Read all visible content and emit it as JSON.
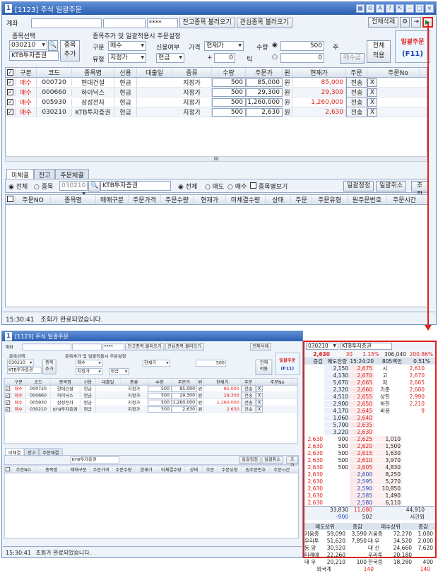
{
  "window": {
    "title": "[1123] 주식 일괄주문",
    "num": "1"
  },
  "top": {
    "account_label": "계좌",
    "password": "****",
    "load_balance": "잔고종목 불러오기",
    "load_watch": "관심종목 불러오기",
    "delete_all": "전체삭제"
  },
  "settings": {
    "select_label": "종목선택",
    "code": "030210",
    "add_label": "종목\n추가",
    "stock_name": "KTB투자증권",
    "section_label": "종목추가 및 일괄적용시 주문설정",
    "side_label": "구분",
    "side_value": "매수",
    "credit_label": "신용여부",
    "price_label": "가격",
    "price_value": "현재가",
    "qty_label": "수량",
    "qty_value": "500",
    "qty_unit": "주",
    "type_label": "유형",
    "type_value": "지정가",
    "credit_value": "현금",
    "tick_value": "0",
    "tick_unit": "틱",
    "price_input": "0",
    "bid_label": "매수금",
    "apply_label": "전체\n적용",
    "bulk_label": "일괄주문",
    "bulk_key": "(F11)"
  },
  "order_grid": {
    "headers": [
      "",
      "구분",
      "코드",
      "종목명",
      "신용",
      "대출일",
      "종류",
      "수량",
      "주문가",
      "원",
      "현재가",
      "주문",
      "",
      "주문No"
    ],
    "rows": [
      {
        "side": "매수",
        "code": "000720",
        "name": "현대건설",
        "credit": "현금",
        "type": "지정가",
        "qty": "500",
        "price": "85,000",
        "won": "원",
        "cur": "85,000",
        "send": "전송",
        "x": "X"
      },
      {
        "side": "매수",
        "code": "000660",
        "name": "하이닉스",
        "credit": "현금",
        "type": "지정가",
        "qty": "500",
        "price": "29,300",
        "won": "원",
        "cur": "29,300",
        "send": "전송",
        "x": "X"
      },
      {
        "side": "매수",
        "code": "005930",
        "name": "삼성전자",
        "credit": "현금",
        "type": "지정가",
        "qty": "500",
        "price": "1,260,000",
        "won": "원",
        "cur": "1,260,000",
        "send": "전송",
        "x": "X"
      },
      {
        "side": "매수",
        "code": "030210",
        "name": "KTB투자증권",
        "credit": "현금",
        "type": "지정가",
        "qty": "500",
        "price": "2,630",
        "won": "원",
        "cur": "2,630",
        "send": "전송",
        "x": "X"
      }
    ]
  },
  "tabs": [
    "미체결",
    "잔고",
    "주문체결"
  ],
  "filter": {
    "all": "전체",
    "stock": "종목",
    "code": "030210",
    "name": "KTB투자증권",
    "all2": "전체",
    "sell": "매도",
    "buy": "매수",
    "by_stock": "종목별보기",
    "bulk_fix": "일괄정정",
    "bulk_cancel": "일괄취소",
    "query": "조회"
  },
  "unfilled_headers": [
    "",
    "주문NO",
    "종목명",
    "매매구분",
    "주문가격",
    "주문수량",
    "현재가",
    "미체결수량",
    "상태",
    "주문",
    "주문유형",
    "원주문번호",
    "주문시간"
  ],
  "status": {
    "time": "15:30:41",
    "msg": "조회가 완료되었습니다."
  },
  "scroll_mark": "III",
  "orderbook": {
    "code": "030210",
    "name": "KTB투자증권",
    "price": "2,630",
    "change": "30",
    "rate": "1.15%",
    "volume": "306,040",
    "pct": "200.86%",
    "hdr": [
      "증감",
      "매도잔량",
      "15:24:20",
      "805백만",
      "0.51%"
    ],
    "asks": [
      [
        "2,150",
        "2,675"
      ],
      [
        "4,130",
        "2,670"
      ],
      [
        "5,670",
        "2,665"
      ],
      [
        "2,320",
        "2,660"
      ],
      [
        "4,510",
        "2,655"
      ],
      [
        "2,900",
        "2,650"
      ],
      [
        "4,170",
        "2,645"
      ],
      [
        "1,060",
        "2,640"
      ],
      [
        "5,700",
        "2,635"
      ],
      [
        "3,220",
        "2,630"
      ]
    ],
    "bids": [
      [
        "2,625",
        "1,010"
      ],
      [
        "2,620",
        "1,500"
      ],
      [
        "2,615",
        "1,630"
      ],
      [
        "2,610",
        "3,970"
      ],
      [
        "2,605",
        "4,830"
      ],
      [
        "2,600",
        "8,250"
      ],
      [
        "2,595",
        "5,270"
      ],
      [
        "2,590",
        "10,850"
      ],
      [
        "2,585",
        "1,490"
      ],
      [
        "2,580",
        "6,110"
      ]
    ],
    "bid_ticks": [
      "2,630",
      "2,630",
      "2,630",
      "2,630",
      "2,630",
      "2,630",
      "2,630",
      "2,630",
      "2,630",
      "2,630"
    ],
    "bid_qty": [
      "900",
      "500",
      "500",
      "500",
      "500",
      "",
      "",
      "",
      "",
      ""
    ],
    "side_info": [
      [
        "시",
        "2,610"
      ],
      [
        "고",
        "2,670"
      ],
      [
        "저",
        "2,605"
      ],
      [
        "기준",
        "2,600"
      ],
      [
        "상한",
        "2,990"
      ],
      [
        "하한",
        "2,210"
      ],
      [
        "비용",
        "9"
      ]
    ],
    "totals": [
      "33,830",
      "11,080",
      "44,910"
    ],
    "sum2": [
      "-900",
      "502",
      "시간외"
    ],
    "brokers_hdr": [
      "매도상위",
      "증감",
      "매수상위",
      "증감"
    ],
    "brokers": [
      [
        "키움증",
        "59,090",
        "3,590",
        "키움증",
        "72,270",
        "1,080"
      ],
      [
        "우리투",
        "51,620",
        "7,850",
        "대 우",
        "34,520",
        "2,000"
      ],
      [
        "동 양",
        "30,520",
        "",
        "대 신",
        "24,660",
        "7,620"
      ],
      [
        "미래에",
        "22,260",
        "",
        "우리투",
        "20,180",
        ""
      ],
      [
        "대 우",
        "20,210",
        "100",
        "한국증",
        "18,280",
        "400"
      ]
    ],
    "foreign": [
      "외국계",
      "140",
      "140"
    ]
  }
}
